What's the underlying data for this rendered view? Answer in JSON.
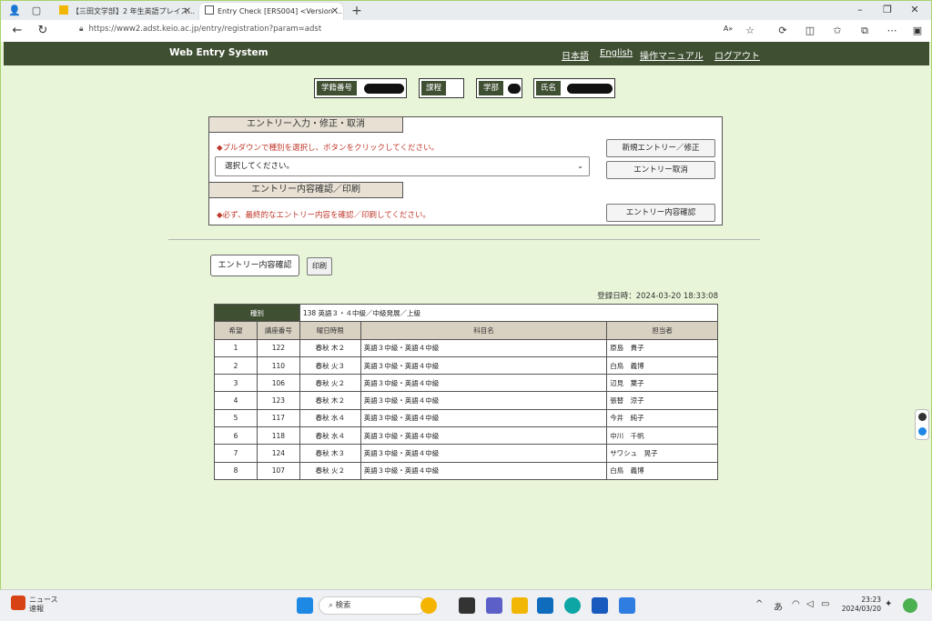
{
  "browser": {
    "tabs": [
      {
        "label": "【三田文学部】2 年生英語プレイス..."
      },
      {
        "label": "Entry Check [ERS004]  <Version ..."
      }
    ],
    "url": "https://www2.adst.keio.ac.jp/entry/registration?param=adst",
    "zoom_icon": "A»"
  },
  "header": {
    "title": "Web Entry System",
    "links": [
      "日本語",
      "English",
      "操作マニュアル",
      "ログアウト"
    ]
  },
  "student_info": {
    "student_id_label": "学籍番号",
    "course_label": "課程",
    "faculty_label": "学部",
    "name_label": "氏名"
  },
  "entry_panel": {
    "section1_title": "エントリー入力・修正・取消",
    "instruction": "◆プルダウンで種別を選択し、ボタンをクリックしてください。",
    "select_placeholder": "選択してください。",
    "new_entry_button": "新規エントリー／修正",
    "cancel_entry_button": "エントリー取消",
    "section2_title": "エントリー内容確認／印刷",
    "confirm_note": "◆必ず、最終的なエントリー内容を確認／印刷してください。",
    "confirm_button": "エントリー内容確認"
  },
  "actions": {
    "confirm_button": "エントリー内容確認",
    "print_button": "印刷"
  },
  "registration": {
    "date_text": "登録日時：2024-03-20 18:33:08",
    "kind_label": "種別",
    "kind_value": "138 英語３・４中級／中級発展／上級",
    "columns": [
      "希望",
      "講座番号",
      "曜日時限",
      "科目名",
      "担当者"
    ],
    "rows": [
      {
        "pref": "1",
        "course_no": "122",
        "period": "春秋 木２",
        "subject": "英語３中級・英語４中級",
        "teacher": "原島　貴子"
      },
      {
        "pref": "2",
        "course_no": "110",
        "period": "春秋 火３",
        "subject": "英語３中級・英語４中級",
        "teacher": "白鳥　義博"
      },
      {
        "pref": "3",
        "course_no": "106",
        "period": "春秋 火２",
        "subject": "英語３中級・英語４中級",
        "teacher": "辺見　葉子"
      },
      {
        "pref": "4",
        "course_no": "123",
        "period": "春秋 木２",
        "subject": "英語３中級・英語４中級",
        "teacher": "張替　涼子"
      },
      {
        "pref": "5",
        "course_no": "117",
        "period": "春秋 水４",
        "subject": "英語３中級・英語４中級",
        "teacher": "今井　純子"
      },
      {
        "pref": "6",
        "course_no": "118",
        "period": "春秋 水４",
        "subject": "英語３中級・英語４中級",
        "teacher": "中川　千帆"
      },
      {
        "pref": "7",
        "course_no": "124",
        "period": "春秋 木３",
        "subject": "英語３中級・英語４中級",
        "teacher": "サワシュ　晃子"
      },
      {
        "pref": "8",
        "course_no": "107",
        "period": "春秋 火２",
        "subject": "英語３中級・英語４中級",
        "teacher": "白鳥　義博"
      }
    ]
  },
  "taskbar": {
    "news_line1": "ニュース",
    "news_line2": "速報",
    "search_label": "検索",
    "ime": "あ",
    "time": "23:23",
    "date": "2024/03/20"
  },
  "colors": {
    "header_bg": "#3f4f32",
    "page_bg": "#e9f5d8",
    "section_head_bg": "#e7e0d3",
    "note_red": "#c0392b"
  }
}
